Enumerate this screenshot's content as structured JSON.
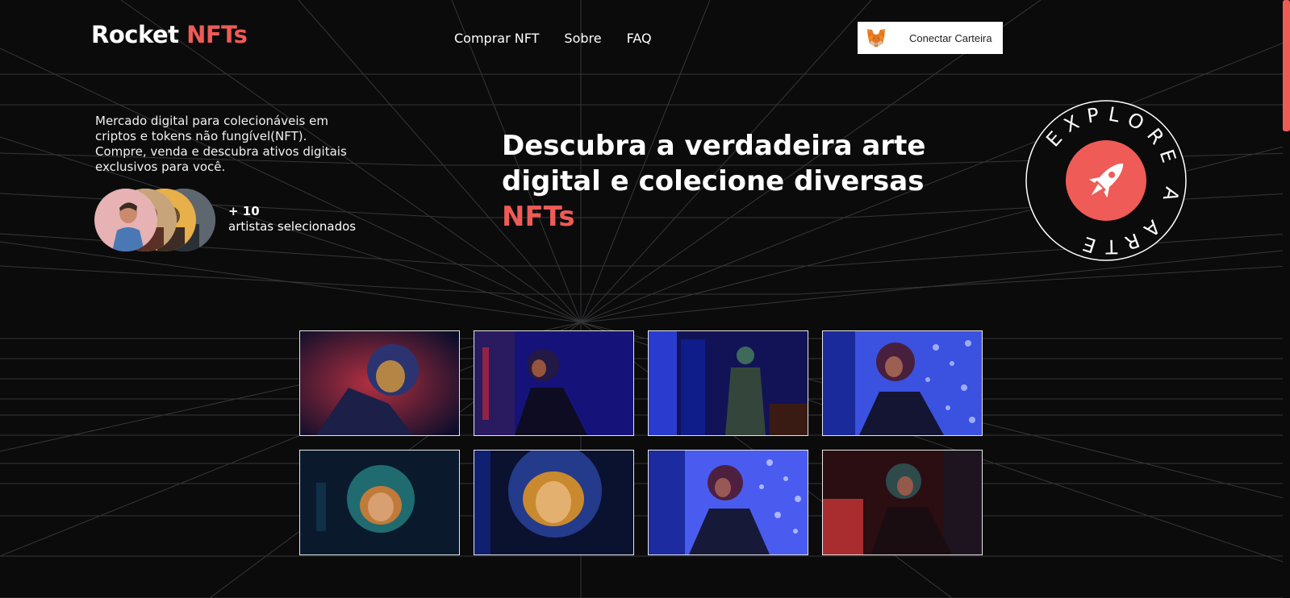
{
  "brand": {
    "name": "Rocket",
    "accent": "NFTs",
    "accent_color": "#ef5b56"
  },
  "nav": {
    "items": [
      {
        "label": "Comprar NFT"
      },
      {
        "label": "Sobre"
      },
      {
        "label": "FAQ"
      }
    ]
  },
  "wallet": {
    "label": "Conectar Carteira",
    "icon": "metamask-fox-icon"
  },
  "intro": {
    "text": "Mercado digital para colecionáveis em criptos e tokens não fungível(NFT). Compre, venda e descubra ativos digitais exclusivos para você."
  },
  "artists": {
    "count": "+ 10",
    "label": "artistas selecionados"
  },
  "hero": {
    "line1": "Descubra a verdadeira arte",
    "line2": "digital e colecione diversas",
    "accent": "NFTs"
  },
  "badge": {
    "text": "EXPLORE A ARTE",
    "icon": "rocket-icon"
  },
  "gallery": {
    "items": [
      {
        "name": "astronaut-red-helmet"
      },
      {
        "name": "astronaut-blue-side"
      },
      {
        "name": "astronaut-green-standing"
      },
      {
        "name": "astronaut-visor-down"
      },
      {
        "name": "astronaut-teal-helmet"
      },
      {
        "name": "astronaut-gold-visor"
      },
      {
        "name": "astronaut-window"
      },
      {
        "name": "astronaut-red-sitting"
      }
    ]
  },
  "colors": {
    "background": "#0b0b0c",
    "accent": "#ef5b56",
    "text": "#ffffff"
  }
}
